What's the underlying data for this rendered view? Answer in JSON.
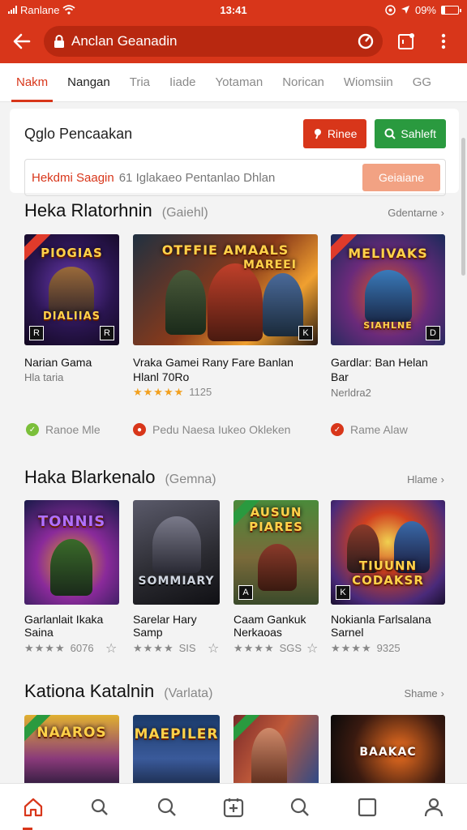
{
  "status_bar": {
    "carrier": "Ranlane",
    "time": "13:41",
    "battery": "09%"
  },
  "app_bar": {
    "url_text": "Anclan Geanadin"
  },
  "tabs": [
    {
      "label": "Nakm"
    },
    {
      "label": "Nangan"
    },
    {
      "label": "Tria"
    },
    {
      "label": "Iiade"
    },
    {
      "label": "Yotaman"
    },
    {
      "label": "Norican"
    },
    {
      "label": "Wiomsiin"
    },
    {
      "label": "GG"
    }
  ],
  "search_card": {
    "title": "Qglo Pencaakan",
    "red_button": "Rinee",
    "green_button": "Sahleft",
    "field_highlight": "Hekdmi Saagin",
    "field_rest": "61 Iglakaeo Pentanlao Dhlan",
    "go_button": "Geiaiane"
  },
  "sections": [
    {
      "title": "Heka Rlatorhnin",
      "sub": "(Gaiehl)",
      "more": "Gdentarne",
      "games": [
        {
          "art": "PIOGIAS",
          "art2": "DIALIIAS",
          "name": "Narian Gama",
          "sub": "Hla taria"
        },
        {
          "art": "OTFFIE AMAALS",
          "art2": "MAREEI",
          "name": "Vraka Gamei Rany Fare Banlan",
          "sub": "Hlanl 70Ro",
          "rating": "1125"
        },
        {
          "art": "MELIVAKS",
          "art2": "SIAHLNE",
          "name": "Gardlar: Ban Helan",
          "sub": "Bar",
          "sub2": "Nerldra2"
        }
      ],
      "pills": [
        {
          "label": "Ranoe Mle",
          "color": "#7bbf3a"
        },
        {
          "label": "Pedu Naesa Iukeo Okleken",
          "color": "#d8361a"
        },
        {
          "label": "Rame Alaw",
          "color": "#d8361a"
        }
      ]
    },
    {
      "title": "Haka Blarkenalo",
      "sub": "(Gemna)",
      "more": "Hlame",
      "games": [
        {
          "art": "TONNIS",
          "name": "Garlanlait Ikaka",
          "sub": "Saina",
          "rating": "6076"
        },
        {
          "art": "SOMMIARY",
          "name": "Sarelar Hary",
          "sub": "Samp",
          "rating": "SIS"
        },
        {
          "art": "AUSUN PIARES",
          "name": "Caam Gankuk",
          "sub": "Nerkaoas",
          "rating": "SGS"
        },
        {
          "art": "TIUUNN CODAKSR",
          "name": "Nokianla Farlsalana",
          "sub": "Sarnel",
          "rating": "9325"
        }
      ]
    },
    {
      "title": "Kationa Katalnin",
      "sub": "(Varlata)",
      "more": "Shame",
      "games": [
        {
          "art": "NAAROS"
        },
        {
          "art": "MAEPILER"
        },
        {
          "art": ""
        },
        {
          "art": "BAAKAC"
        }
      ]
    }
  ],
  "colors": {
    "brand": "#d8361a",
    "green": "#2a9a3f",
    "star": "#f2a01e"
  },
  "bottom_nav": [
    {
      "icon": "home-icon"
    },
    {
      "icon": "search-icon"
    },
    {
      "icon": "search-icon"
    },
    {
      "icon": "add-icon"
    },
    {
      "icon": "search-icon"
    },
    {
      "icon": "square-icon"
    },
    {
      "icon": "profile-icon"
    }
  ]
}
